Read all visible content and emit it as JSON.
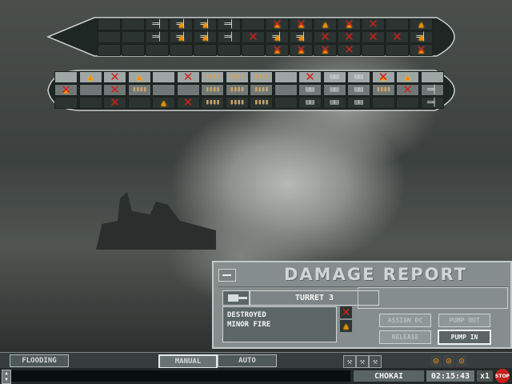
{
  "panel": {
    "title": "DAMAGE REPORT",
    "component_name": "TURRET 3",
    "status_lines": [
      "DESTROYED",
      "MINOR FIRE"
    ],
    "status_icons": [
      "destroyed-x-icon",
      "fire-icon"
    ],
    "buttons": {
      "assign_dc": "ASSIGN DC",
      "pump_out": "PUMP OUT",
      "release": "RELEASE",
      "pump_in": "PUMP IN"
    },
    "active_button": "pump_in"
  },
  "bottom_bar": {
    "flooding": "FLOODING",
    "manual": "MANUAL",
    "auto": "AUTO",
    "selected_mode": "manual",
    "tools": [
      "wrench-icon",
      "wrench-icon",
      "wrench-icon"
    ],
    "indicators": [
      "gauge-icon",
      "gauge-icon",
      "gauge-icon"
    ]
  },
  "status_bar": {
    "ship_name": "CHOKAI",
    "clock": "02:15:43",
    "speed": "x1",
    "stop_label": "STOP"
  },
  "colors": {
    "fire": "#ff8a00",
    "destroyed": "#d0201a",
    "panel": "#858d8d"
  },
  "deck_rows": [
    [
      "",
      "",
      "gun",
      "gun-fire",
      "gun-fire",
      "gun",
      "",
      "fire-x",
      "fire-x",
      "fire",
      "fire-x",
      "x",
      "",
      "fire",
      "",
      ""
    ],
    [
      "",
      "",
      "gun",
      "gun-fire",
      "gun-fire",
      "gun",
      "x",
      "gun-fire",
      "gun-fire",
      "x",
      "x",
      "x",
      "x",
      "gun-fire",
      "gun-fire",
      "gun"
    ],
    [
      "",
      "",
      "",
      "",
      "",
      "",
      "",
      "fire-x",
      "fire-x",
      "fire-x",
      "x",
      "",
      "",
      "fire-x",
      "",
      ""
    ]
  ],
  "lower_rows": [
    [
      "",
      "fire",
      "x",
      "fire",
      "",
      "x",
      "ammo",
      "ammo",
      "ammo",
      "",
      "x",
      "mach",
      "mach",
      "fire-x",
      "fire",
      ""
    ],
    [
      "fire-x",
      "",
      "x",
      "ammo",
      "",
      "",
      "ammo",
      "ammo",
      "ammo",
      "",
      "mach",
      "mach",
      "mach",
      "ammo",
      "x",
      "gun"
    ],
    [
      "",
      "",
      "x",
      "",
      "fire",
      "x",
      "ammo",
      "ammo",
      "ammo",
      "",
      "mach",
      "mach",
      "mach",
      "",
      "",
      "gun"
    ]
  ]
}
